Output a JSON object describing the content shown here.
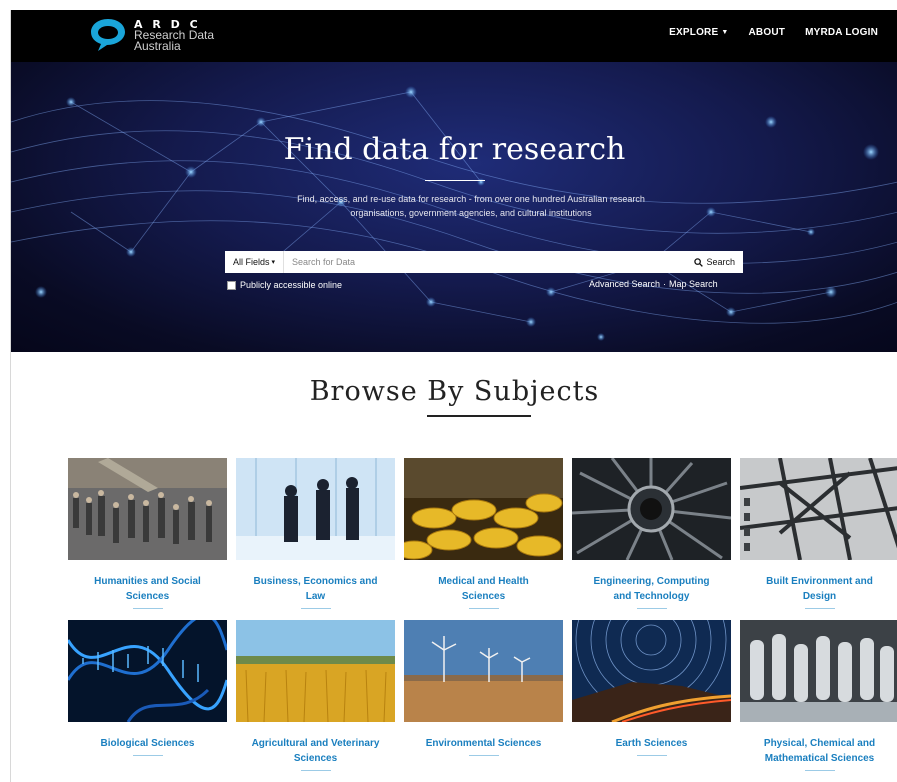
{
  "brand": {
    "ardc": "A R D C",
    "name_line1": "Research Data",
    "name_line2": "Australia",
    "accent": "#1aa5d9"
  },
  "nav": {
    "explore": "EXPLORE",
    "about": "ABOUT",
    "login": "MYRDA LOGIN"
  },
  "hero": {
    "title": "Find data for research",
    "subtitle": "Find, access, and re-use data for research - from over one hundred Australian research organisations, government agencies, and cultural institutions"
  },
  "search": {
    "fields_label": "All Fields",
    "placeholder": "Search for Data",
    "button_label": "Search",
    "checkbox_label": "Publicly accessible online",
    "advanced_link": "Advanced Search",
    "separator": "·",
    "map_link": "Map Search"
  },
  "browse": {
    "title": "Browse By Subjects",
    "subjects": [
      {
        "line1": "Humanities and Social",
        "line2": "Sciences"
      },
      {
        "line1": "Business, Economics and",
        "line2": "Law"
      },
      {
        "line1": "Medical and Health",
        "line2": "Sciences"
      },
      {
        "line1": "Engineering, Computing",
        "line2": "and Technology"
      },
      {
        "line1": "Built Environment and",
        "line2": "Design"
      },
      {
        "line1": "Biological Sciences",
        "line2": ""
      },
      {
        "line1": "Agricultural and Veterinary",
        "line2": "Sciences"
      },
      {
        "line1": "Environmental Sciences",
        "line2": ""
      },
      {
        "line1": "Earth Sciences",
        "line2": ""
      },
      {
        "line1": "Physical, Chemical and",
        "line2": "Mathematical Sciences"
      }
    ]
  },
  "colors": {
    "subject_link": "#1a7fbf",
    "navbar": "#000000"
  }
}
